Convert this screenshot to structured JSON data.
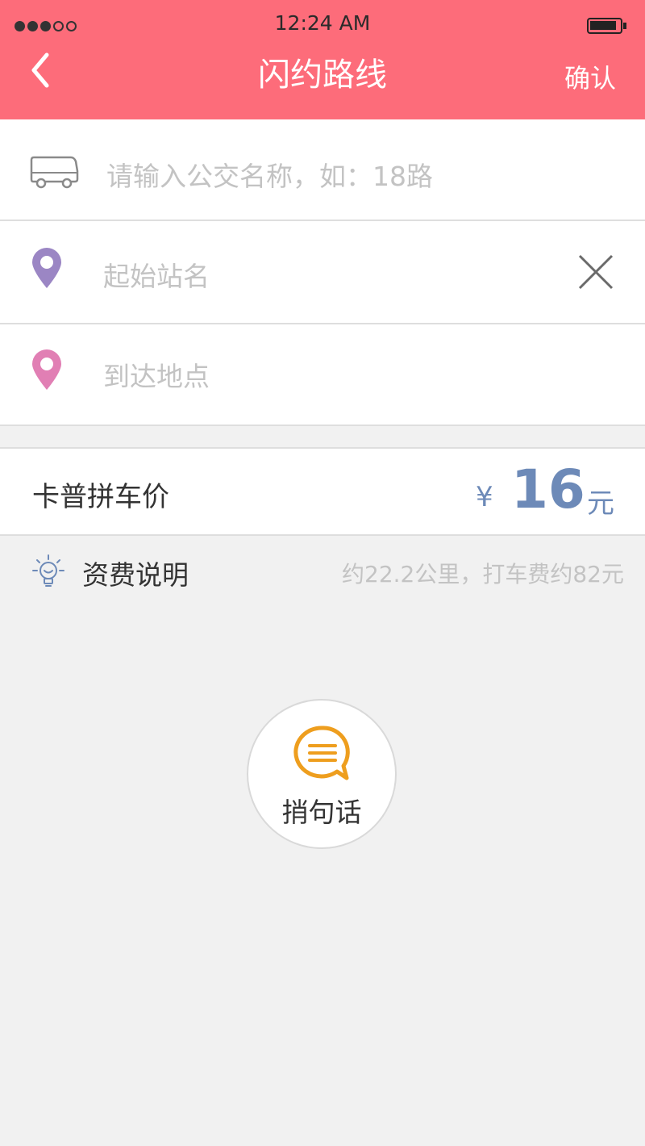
{
  "status_bar": {
    "time": "12:24 AM",
    "signal_bars_filled": 3,
    "signal_bars_total": 5
  },
  "header": {
    "title": "闪约路线",
    "confirm_label": "确认",
    "back_icon": "chevron-left-icon",
    "background_color": "#fd6c7a"
  },
  "route_form": {
    "bus_placeholder": "请输入公交名称，如：18路",
    "bus_icon": "bus-icon",
    "start_placeholder": "起始站名",
    "start_icon": "map-pin-purple-icon",
    "start_pin_color": "#9b86c4",
    "clear_icon": "close-icon",
    "destination_placeholder": "到达地点",
    "destination_icon": "map-pin-pink-icon",
    "destination_pin_color": "#e17fb4"
  },
  "price": {
    "label": "卡普拼车价",
    "currency_symbol": "¥",
    "amount": "16",
    "unit": "元",
    "accent_color": "#6d8ab8"
  },
  "fee_info": {
    "label": "资费说明",
    "icon": "lightbulb-icon",
    "note": "约22.2公里，打车费约82元"
  },
  "message_button": {
    "label": "捎句话",
    "icon": "chat-bubble-icon",
    "icon_color": "#ee9e1e"
  }
}
